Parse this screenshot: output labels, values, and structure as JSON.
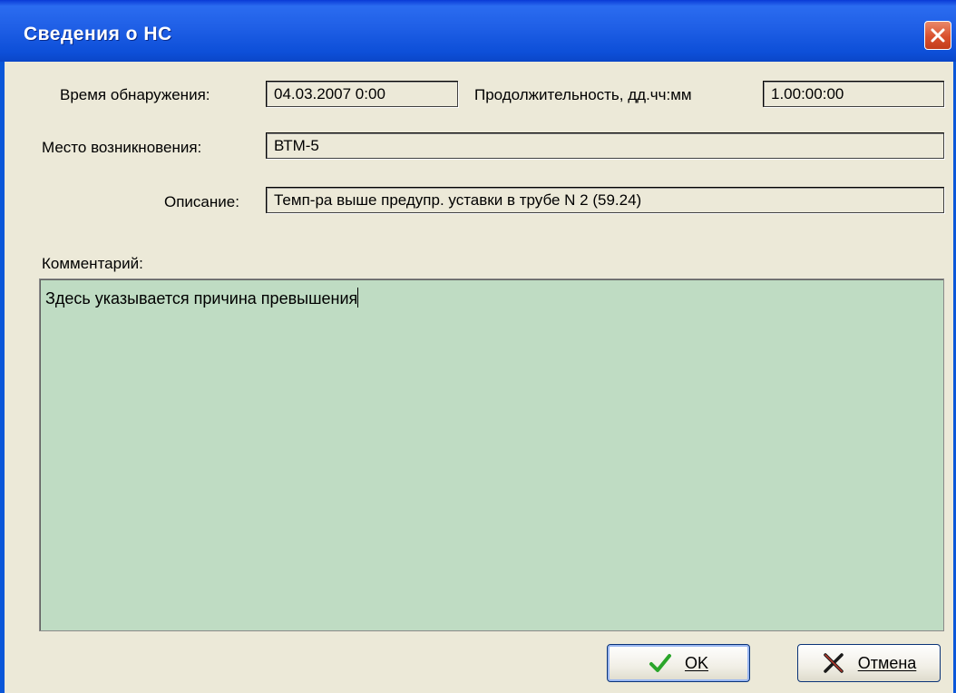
{
  "window": {
    "title": "Сведения о НС"
  },
  "fields": {
    "detect_time": {
      "label": "Время обнаружения:",
      "value": "04.03.2007 0:00"
    },
    "duration": {
      "label": "Продолжительность, дд.чч:мм",
      "value": "1.00:00:00"
    },
    "location": {
      "label": "Место возникновения:",
      "value": "ВТМ-5"
    },
    "description": {
      "label": "Описание:",
      "value": "Темп-ра выше предупр. уставки в трубе N 2 (59.24)"
    }
  },
  "comment": {
    "label": "Комментарий:",
    "value": "Здесь указывается причина превышения"
  },
  "buttons": {
    "ok": {
      "label": "OK",
      "icon": "checkmark-icon",
      "color": "#2aa52a"
    },
    "cancel": {
      "label": "Отмена",
      "icon": "cross-icon",
      "color": "#1a1a1a"
    }
  },
  "colors": {
    "titlebar": "#1f5fe6",
    "dialog_bg": "#ece9d8",
    "comment_bg": "#bfdcc3",
    "close_button": "#d9502e"
  }
}
